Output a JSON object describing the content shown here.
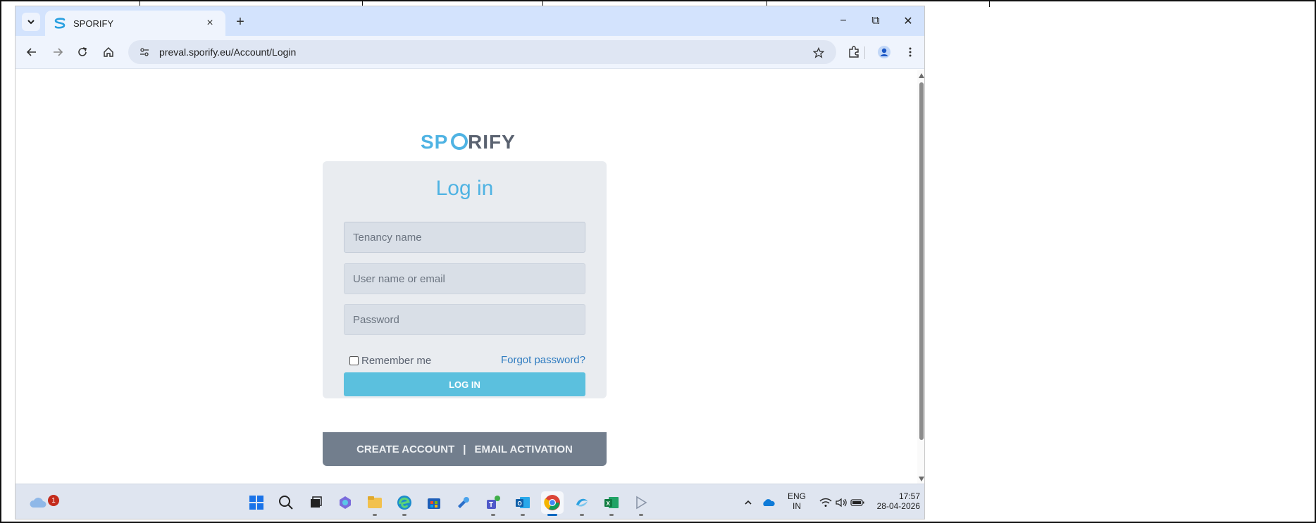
{
  "browser": {
    "tab_title": "SPORIFY",
    "url_domain": "preval.sporify.eu",
    "url_path": "/Account/Login",
    "new_tab_symbol": "+",
    "close_tab_symbol": "×",
    "minimize_symbol": "−",
    "restore_symbol": "⧉",
    "close_symbol": "✕"
  },
  "page": {
    "logo_text": "SPORIFY",
    "heading": "Log in",
    "fields": {
      "tenancy_placeholder": "Tenancy name",
      "username_placeholder": "User name or email",
      "password_placeholder": "Password"
    },
    "remember_label": "Remember me",
    "forgot_link": "Forgot password?",
    "login_button": "LOG IN",
    "footer_create": "CREATE ACCOUNT",
    "footer_sep": "|",
    "footer_activation": "EMAIL ACTIVATION"
  },
  "taskbar": {
    "weather_badge": "1",
    "language_top": "ENG",
    "language_bottom": "IN",
    "time": "17:57",
    "date": "28-04-2026"
  },
  "colors": {
    "accent": "#4fb3e3",
    "login_button": "#5bc0de",
    "footer": "#727e8d",
    "tab_strip": "#d3e3fd"
  }
}
